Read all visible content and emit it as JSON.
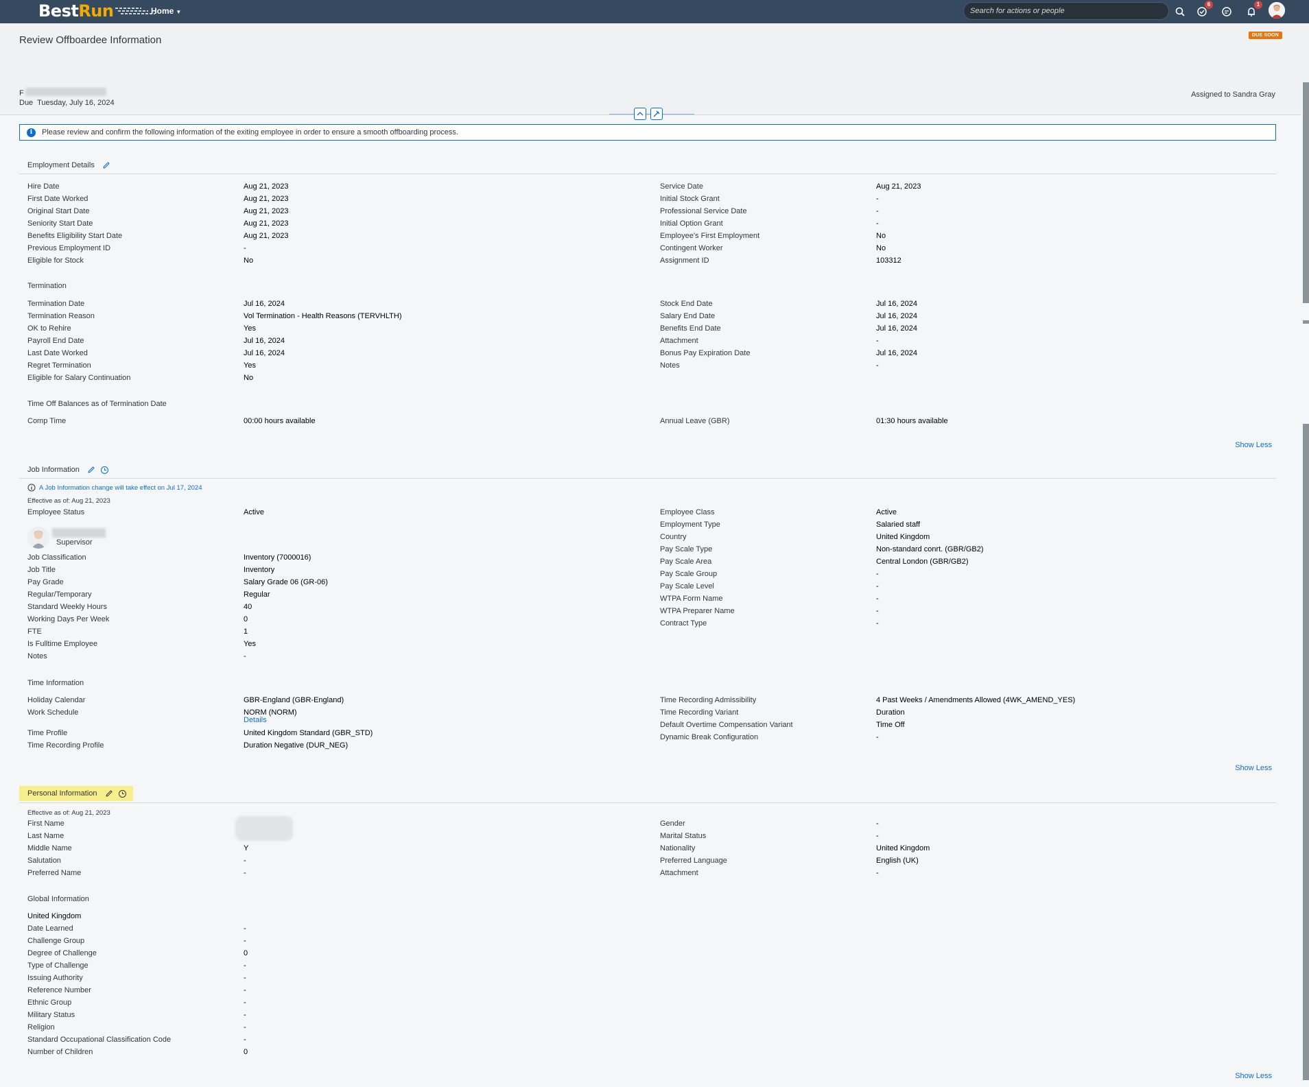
{
  "shell": {
    "logo_best": "Best",
    "logo_run": "Run",
    "home_label": "Home",
    "search_placeholder": "Search for actions or people",
    "todo_badge": "6",
    "notif_badge": "1"
  },
  "header": {
    "title": "Review Offboardee Information",
    "due_badge": "DUE SOON",
    "from_prefix": "F",
    "due_label": "Due",
    "due_date": "Tuesday, July 16, 2024",
    "assigned": "Assigned to Sandra Gray"
  },
  "info_message": "Please review and confirm the following information of the exiting employee in order to ensure a smooth offboarding process.",
  "employment": {
    "title": "Employment Details",
    "left": [
      {
        "label": "Hire Date",
        "value": "Aug 21, 2023"
      },
      {
        "label": "First Date Worked",
        "value": "Aug 21, 2023"
      },
      {
        "label": "Original Start Date",
        "value": "Aug 21, 2023"
      },
      {
        "label": "Seniority Start Date",
        "value": "Aug 21, 2023"
      },
      {
        "label": "Benefits Eligibility Start Date",
        "value": "Aug 21, 2023"
      },
      {
        "label": "Previous Employment ID",
        "value": "-"
      },
      {
        "label": "Eligible for Stock",
        "value": "No"
      }
    ],
    "right": [
      {
        "label": "Service Date",
        "value": "Aug 21, 2023"
      },
      {
        "label": "Initial Stock Grant",
        "value": "-"
      },
      {
        "label": "Professional Service Date",
        "value": "-"
      },
      {
        "label": "Initial Option Grant",
        "value": "-"
      },
      {
        "label": "Employee's First Employment",
        "value": "No"
      },
      {
        "label": "Contingent Worker",
        "value": "No"
      },
      {
        "label": "Assignment ID",
        "value": "103312"
      }
    ],
    "termination_title": "Termination",
    "termination_left": [
      {
        "label": "Termination Date",
        "value": "Jul 16, 2024"
      },
      {
        "label": "Termination Reason",
        "value": "Vol Termination - Health Reasons (TERVHLTH)"
      },
      {
        "label": "OK to Rehire",
        "value": "Yes"
      },
      {
        "label": "Payroll End Date",
        "value": "Jul 16, 2024"
      },
      {
        "label": "Last Date Worked",
        "value": "Jul 16, 2024"
      },
      {
        "label": "Regret Termination",
        "value": "Yes"
      },
      {
        "label": "Eligible for Salary Continuation",
        "value": "No"
      }
    ],
    "termination_right": [
      {
        "label": "Stock End Date",
        "value": "Jul 16, 2024"
      },
      {
        "label": "Salary End Date",
        "value": "Jul 16, 2024"
      },
      {
        "label": "Benefits End Date",
        "value": "Jul 16, 2024"
      },
      {
        "label": "Attachment",
        "value": "-"
      },
      {
        "label": "Bonus Pay Expiration Date",
        "value": "Jul 16, 2024"
      },
      {
        "label": "Notes",
        "value": "-"
      }
    ],
    "timeoff_title": "Time Off Balances as of Termination Date",
    "timeoff_left": [
      {
        "label": "Comp Time",
        "value": "00:00 hours available"
      }
    ],
    "timeoff_right": [
      {
        "label": "Annual Leave (GBR)",
        "value": "01:30 hours available"
      }
    ],
    "show_less": "Show Less"
  },
  "job": {
    "title": "Job Information",
    "change_notice": "A Job Information change will take effect on Jul 17, 2024",
    "effective": "Effective as of: Aug 21, 2023",
    "status_label": "Employee Status",
    "status_value": "Active",
    "supervisor_label": "Supervisor",
    "left": [
      {
        "label": "Job Classification",
        "value": "Inventory (7000016)"
      },
      {
        "label": "Job Title",
        "value": "Inventory"
      },
      {
        "label": "Pay Grade",
        "value": "Salary Grade 06 (GR-06)"
      },
      {
        "label": "Regular/Temporary",
        "value": "Regular"
      },
      {
        "label": "Standard Weekly Hours",
        "value": "40"
      },
      {
        "label": "Working Days Per Week",
        "value": "0"
      },
      {
        "label": "FTE",
        "value": "1"
      },
      {
        "label": "Is Fulltime Employee",
        "value": "Yes"
      },
      {
        "label": "Notes",
        "value": "-"
      }
    ],
    "right": [
      {
        "label": "Employee Class",
        "value": "Active"
      },
      {
        "label": "Employment Type",
        "value": "Salaried staff"
      },
      {
        "label": "Country",
        "value": "United Kingdom"
      },
      {
        "label": "Pay Scale Type",
        "value": "Non-standard conrt. (GBR/GB2)"
      },
      {
        "label": "Pay Scale Area",
        "value": "Central London (GBR/GB2)"
      },
      {
        "label": "Pay Scale Group",
        "value": "-"
      },
      {
        "label": "Pay Scale Level",
        "value": "-"
      },
      {
        "label": "WTPA Form Name",
        "value": "-"
      },
      {
        "label": "WTPA Preparer Name",
        "value": "-"
      },
      {
        "label": "Contract Type",
        "value": "-"
      }
    ],
    "time_title": "Time Information",
    "time_left_1": [
      {
        "label": "Holiday Calendar",
        "value": "GBR-England (GBR-England)"
      },
      {
        "label": "Work Schedule",
        "value": "NORM (NORM)"
      }
    ],
    "details_link": "Details",
    "time_left_2": [
      {
        "label": "Time Profile",
        "value": "United Kingdom Standard (GBR_STD)"
      },
      {
        "label": "Time Recording Profile",
        "value": "Duration Negative (DUR_NEG)"
      }
    ],
    "time_right": [
      {
        "label": "Time Recording Admissibility",
        "value": "4 Past Weeks / Amendments Allowed (4WK_AMEND_YES)"
      },
      {
        "label": "Time Recording Variant",
        "value": "Duration"
      },
      {
        "label": "Default Overtime Compensation Variant",
        "value": "Time Off"
      },
      {
        "label": "Dynamic Break Configuration",
        "value": "-"
      }
    ],
    "show_less": "Show Less"
  },
  "personal": {
    "title": "Personal Information",
    "effective": "Effective as of: Aug 21, 2023",
    "left": [
      {
        "label": "First Name",
        "value": ""
      },
      {
        "label": "Last Name",
        "value": ""
      },
      {
        "label": "Middle Name",
        "value": "Y"
      },
      {
        "label": "Salutation",
        "value": "-"
      },
      {
        "label": "Preferred Name",
        "value": "-"
      }
    ],
    "right": [
      {
        "label": "Gender",
        "value": "-"
      },
      {
        "label": "Marital Status",
        "value": "-"
      },
      {
        "label": "Nationality",
        "value": "United Kingdom"
      },
      {
        "label": "Preferred Language",
        "value": "English (UK)"
      },
      {
        "label": "Attachment",
        "value": "-"
      }
    ],
    "global_title": "Global Information",
    "global_country": "United Kingdom",
    "global": [
      {
        "label": "Date Learned",
        "value": "-"
      },
      {
        "label": "Challenge Group",
        "value": "-"
      },
      {
        "label": "Degree of Challenge",
        "value": "0"
      },
      {
        "label": "Type of Challenge",
        "value": "-"
      },
      {
        "label": "Issuing Authority",
        "value": "-"
      },
      {
        "label": "Reference Number",
        "value": "-"
      },
      {
        "label": "Ethnic Group",
        "value": "-"
      },
      {
        "label": "Military Status",
        "value": "-"
      },
      {
        "label": "Religion",
        "value": "-"
      },
      {
        "label": "Standard Occupational Classification Code",
        "value": "-"
      },
      {
        "label": "Number of Children",
        "value": "0"
      }
    ],
    "show_less": "Show Less"
  }
}
